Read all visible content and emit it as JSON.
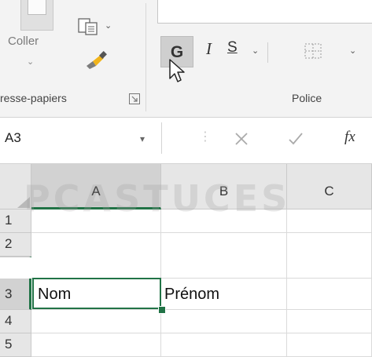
{
  "ribbon": {
    "clipboard": {
      "paste_label": "Coller",
      "paste_caret": "⌄",
      "copy_caret": "⌄",
      "group_label": "resse-papiers"
    },
    "font": {
      "bold_label": "G",
      "italic_label": "I",
      "underline_label": "S",
      "underline_caret": "⌄",
      "border_caret": "⌄",
      "group_label": "Police"
    }
  },
  "formula_bar": {
    "name_box_value": "A3",
    "name_box_caret": "▾",
    "separator": "⋮",
    "fx_label": "fx"
  },
  "grid": {
    "columns": [
      "A",
      "B",
      "C"
    ],
    "rows": [
      "1",
      "2",
      "3",
      "4",
      "5"
    ],
    "cells": {
      "A3": "Nom",
      "B3": "Prénom"
    },
    "selected_cell": "A3"
  },
  "colors": {
    "accent": "#217346",
    "ribbon_bg": "#f3f3f3",
    "header_bg": "#e6e6e6"
  },
  "icons": [
    "paste-icon",
    "copy-icon",
    "format-painter-icon",
    "dialog-launcher-icon",
    "border-icon",
    "mouse-cursor-icon",
    "cancel-icon",
    "enter-icon",
    "select-all-icon"
  ]
}
